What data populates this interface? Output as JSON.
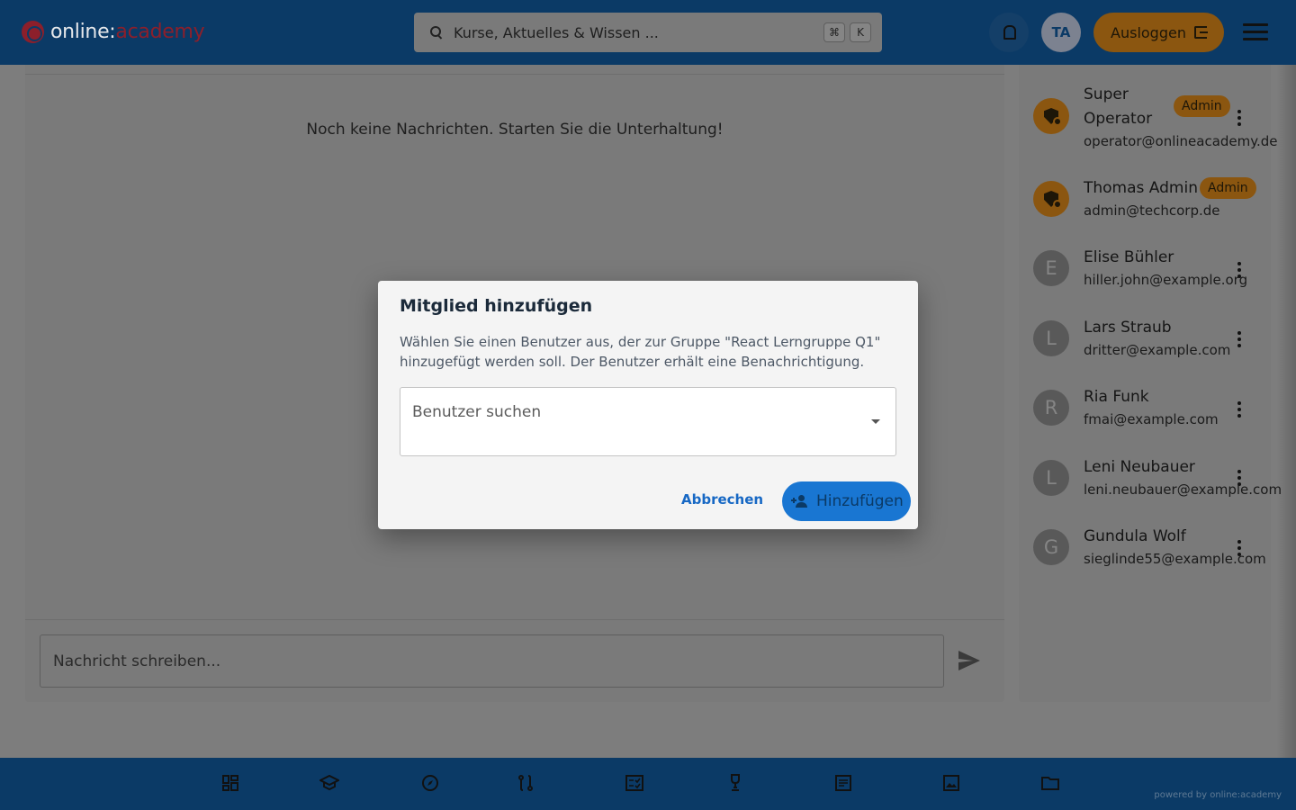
{
  "header": {
    "logo_part1": "online:",
    "logo_part2": "academy",
    "search_placeholder": "Kurse, Aktuelles & Wissen ...",
    "search_shortcut_1": "⌘",
    "search_shortcut_2": "K",
    "avatar_initials": "TA",
    "logout_label": "Ausloggen"
  },
  "chat": {
    "empty_message": "Noch keine Nachrichten. Starten Sie die Unterhaltung!",
    "input_placeholder": "Nachricht schreiben..."
  },
  "members": [
    {
      "name_line1": "Super",
      "name_line2": "Operator",
      "email": "operator@onlineacademy.de",
      "badge": "Admin",
      "initial": "",
      "role": "admin"
    },
    {
      "name_line1": "Thomas Admin",
      "name_line2": "",
      "email": "admin@techcorp.de",
      "badge": "Admin",
      "initial": "",
      "role": "admin"
    },
    {
      "name_line1": "Elise Bühler",
      "name_line2": "",
      "email": "hiller.john@example.org",
      "badge": "",
      "initial": "E",
      "role": "member"
    },
    {
      "name_line1": "Lars Straub",
      "name_line2": "",
      "email": "dritter@example.com",
      "badge": "",
      "initial": "L",
      "role": "member"
    },
    {
      "name_line1": "Ria Funk",
      "name_line2": "",
      "email": "fmai@example.com",
      "badge": "",
      "initial": "R",
      "role": "member"
    },
    {
      "name_line1": "Leni Neubauer",
      "name_line2": "",
      "email": "leni.neubauer@example.com",
      "badge": "",
      "initial": "L",
      "role": "member"
    },
    {
      "name_line1": "Gundula Wolf",
      "name_line2": "",
      "email": "sieglinde55@example.com",
      "badge": "",
      "initial": "G",
      "role": "member"
    }
  ],
  "dialog": {
    "title": "Mitglied hinzufügen",
    "description": "Wählen Sie einen Benutzer aus, der zur Gruppe \"React Lerngruppe Q1\" hinzugefügt werden soll. Der Benutzer erhält eine Benachrichtigung.",
    "select_label": "Benutzer suchen",
    "cancel_label": "Abbrechen",
    "add_label": "Hinzufügen"
  },
  "bottom_nav": {
    "items": [
      "dashboard-icon",
      "school-icon",
      "compass-icon",
      "route-icon",
      "checklist-icon",
      "trophy-icon",
      "article-icon",
      "image-icon",
      "folder-icon"
    ],
    "powered_by": "powered by online:academy"
  },
  "colors": {
    "header_bg": "#0b3a66",
    "accent_orange": "#8b5610",
    "primary_blue": "#1976d2",
    "brand_red": "#8c1f2b"
  }
}
